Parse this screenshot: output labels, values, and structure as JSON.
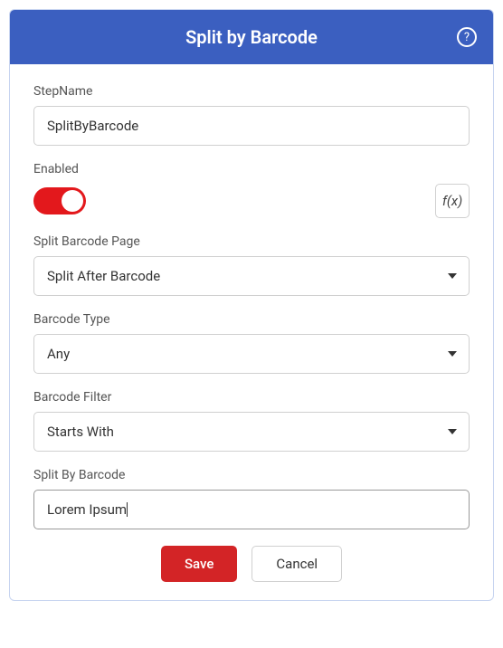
{
  "header": {
    "title": "Split by Barcode"
  },
  "fields": {
    "stepName": {
      "label": "StepName",
      "value": "SplitByBarcode"
    },
    "enabled": {
      "label": "Enabled",
      "fx_label": "f(x)"
    },
    "splitBarcodePage": {
      "label": "Split Barcode Page",
      "value": "Split After Barcode"
    },
    "barcodeType": {
      "label": "Barcode Type",
      "value": "Any"
    },
    "barcodeFilter": {
      "label": "Barcode Filter",
      "value": "Starts With"
    },
    "splitByBarcode": {
      "label": "Split By Barcode",
      "value": "Lorem Ipsum"
    }
  },
  "buttons": {
    "save": "Save",
    "cancel": "Cancel"
  }
}
